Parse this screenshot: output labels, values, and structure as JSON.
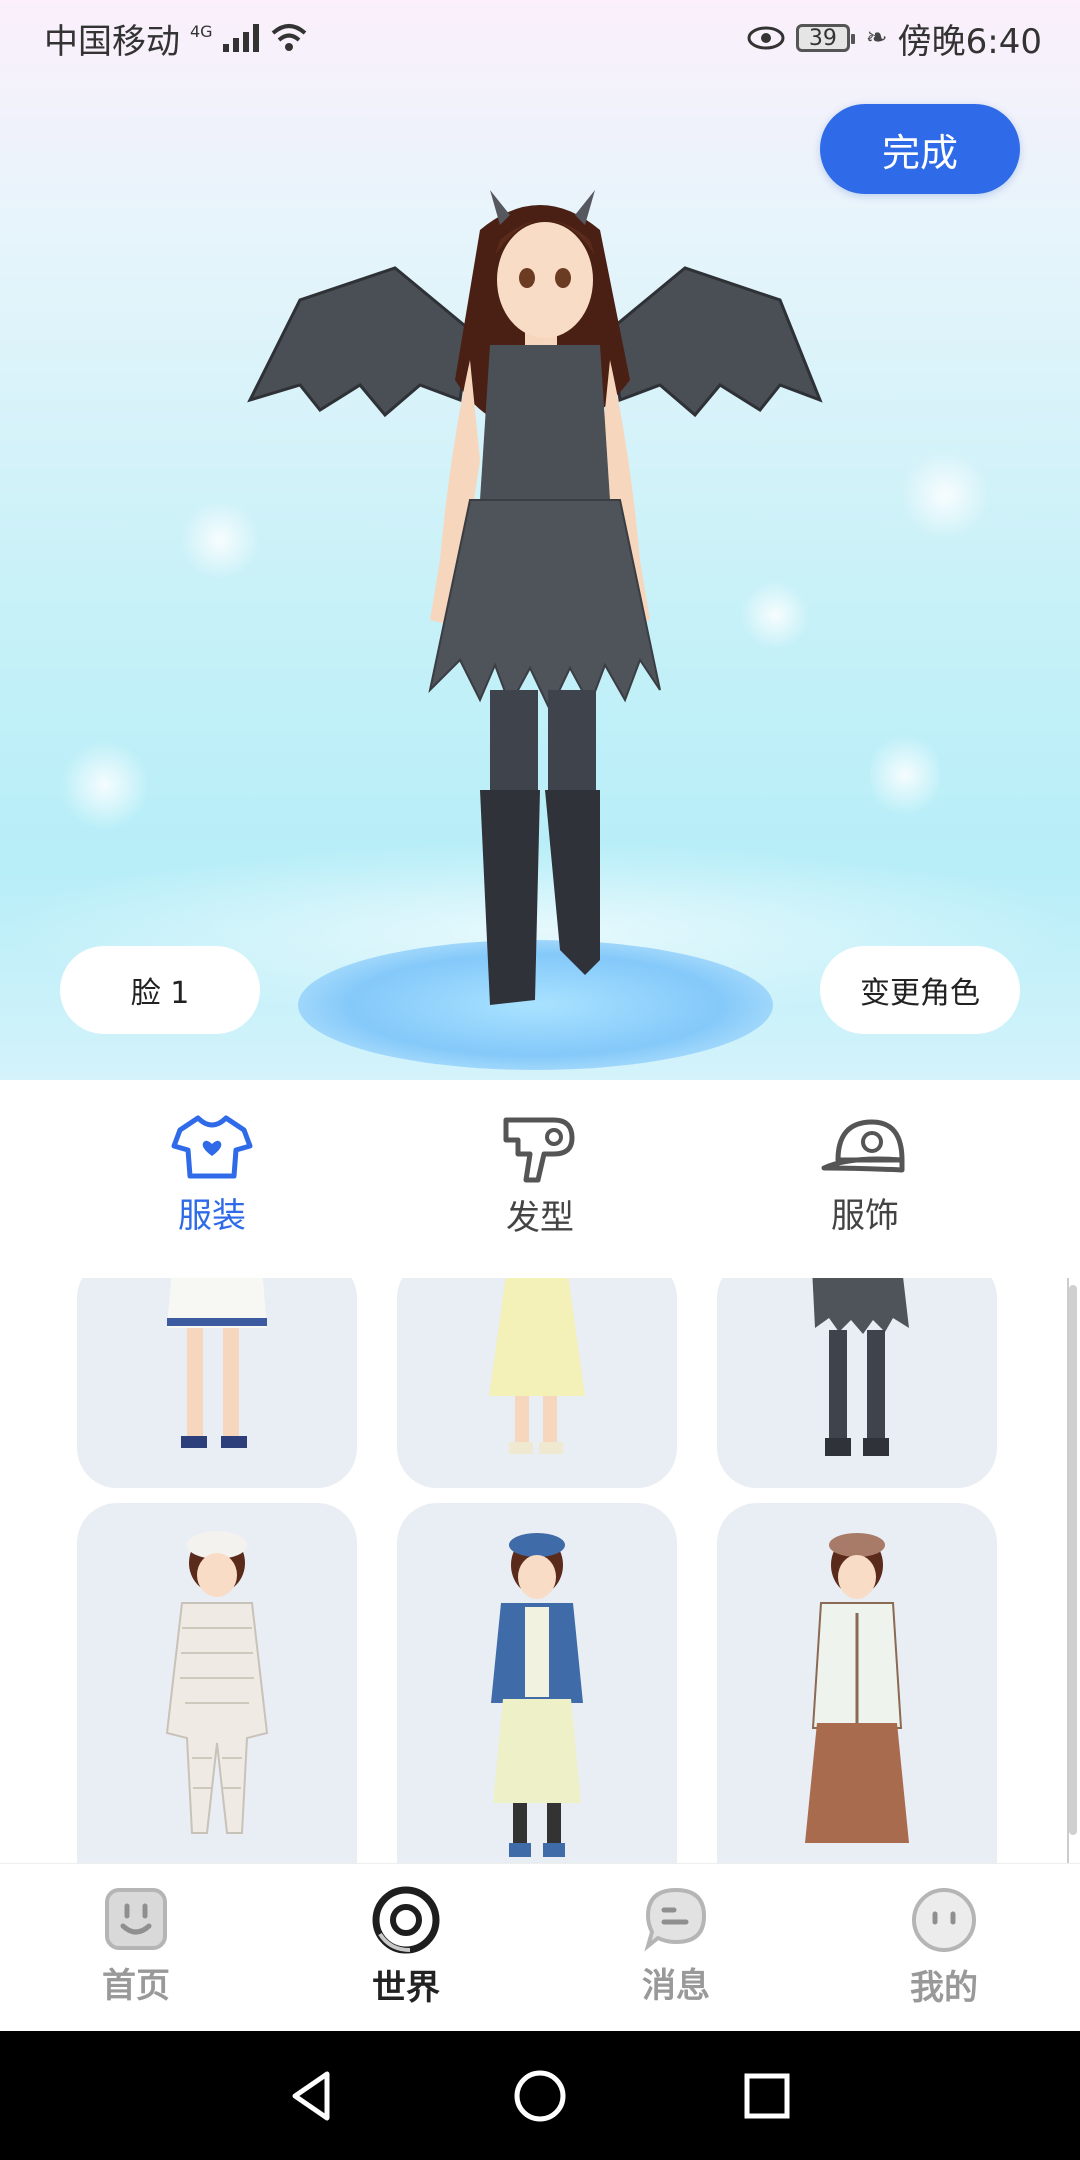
{
  "status_bar": {
    "carrier": "中国移动",
    "network": "4G",
    "battery": "39",
    "time": "傍晚6:40"
  },
  "scene": {
    "done_label": "完成",
    "face_label": "脸 1",
    "change_role_label": "变更角色"
  },
  "tabs": [
    {
      "label": "服装",
      "icon": "tshirt-icon",
      "active": true
    },
    {
      "label": "发型",
      "icon": "hairdryer-icon",
      "active": false
    },
    {
      "label": "服饰",
      "icon": "cap-icon",
      "active": false
    }
  ],
  "outfits": [
    {
      "name": "white-sailor-dress",
      "color": "#f4f4f4"
    },
    {
      "name": "yellow-long-dress",
      "color": "#f3f0b8"
    },
    {
      "name": "black-bat-dress",
      "color": "#555a62"
    },
    {
      "name": "bandage-mummy-suit",
      "color": "#efeae4"
    },
    {
      "name": "denim-jacket-skirt",
      "color": "#3f6ba8"
    },
    {
      "name": "white-coat-brown-skirt",
      "color": "#a86b4e"
    }
  ],
  "bottom_nav": [
    {
      "label": "首页",
      "icon": "home-face-icon",
      "active": false
    },
    {
      "label": "世界",
      "icon": "world-target-icon",
      "active": true
    },
    {
      "label": "消息",
      "icon": "message-bubble-icon",
      "active": false
    },
    {
      "label": "我的",
      "icon": "profile-face-icon",
      "active": false
    }
  ],
  "colors": {
    "accent": "#2f6be8",
    "card_bg": "#e9edf4",
    "inactive": "#999999"
  }
}
